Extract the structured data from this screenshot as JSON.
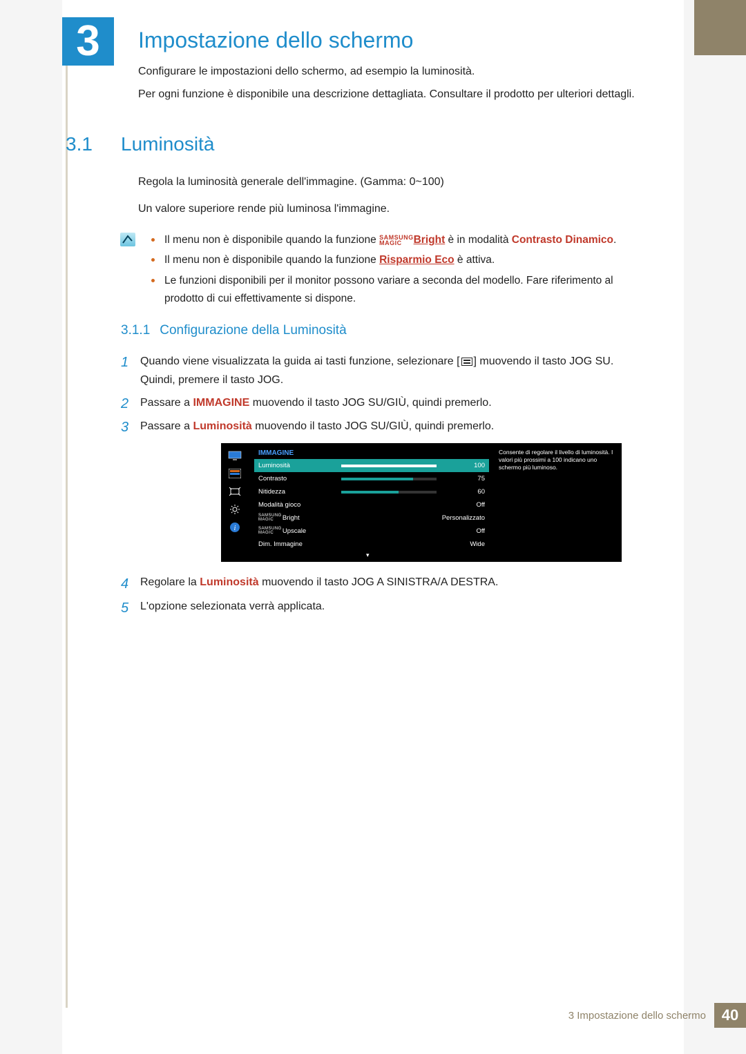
{
  "chapter": {
    "num": "3",
    "title": "Impostazione dello schermo"
  },
  "intro": {
    "p1": "Configurare le impostazioni dello schermo, ad esempio la luminosità.",
    "p2": "Per ogni funzione è disponibile una descrizione dettagliata. Consultare il prodotto per ulteriori dettagli."
  },
  "sec": {
    "num": "3.1",
    "title": "Luminosità"
  },
  "body": {
    "p1": "Regola la luminosità generale dell'immagine. (Gamma: 0~100)",
    "p2": "Un valore superiore rende più luminosa l'immagine."
  },
  "bullets": {
    "b1_a": "Il menu non è disponibile quando la funzione ",
    "b1_tag_top": "SAMSUNG",
    "b1_tag_bot": "MAGIC",
    "b1_bright": "Bright",
    "b1_b": " è in modalità ",
    "b1_mode": "Contrasto Dinamico",
    "b1_c": ".",
    "b2_a": "Il menu non è disponibile quando la funzione ",
    "b2_eco": "Risparmio Eco",
    "b2_b": " è attiva.",
    "b3": "Le funzioni disponibili per il monitor possono variare a seconda del modello. Fare riferimento al prodotto di cui effettivamente si dispone."
  },
  "subsec": {
    "num": "3.1.1",
    "title": "Configurazione della Luminosità"
  },
  "steps": {
    "s1a": "Quando viene visualizzata la guida ai tasti funzione, selezionare [",
    "s1b": "] muovendo il tasto JOG SU. Quindi, premere il tasto JOG.",
    "s2a": "Passare a ",
    "s2k": "IMMAGINE",
    "s2b": " muovendo il tasto JOG SU/GIÙ, quindi premerlo.",
    "s3a": "Passare a ",
    "s3k": "Luminosità",
    "s3b": " muovendo il tasto JOG SU/GIÙ, quindi premerlo.",
    "s4a": "Regolare la ",
    "s4k": "Luminosità",
    "s4b": " muovendo il tasto JOG A SINISTRA/A DESTRA.",
    "s5": "L'opzione selezionata verrà applicata."
  },
  "step_nums": {
    "n1": "1",
    "n2": "2",
    "n3": "3",
    "n4": "4",
    "n5": "5"
  },
  "osd": {
    "header": "IMMAGINE",
    "rows": {
      "r1": {
        "label": "Luminosità",
        "val": "100",
        "pct": 100
      },
      "r2": {
        "label": "Contrasto",
        "val": "75",
        "pct": 75
      },
      "r3": {
        "label": "Nitidezza",
        "val": "60",
        "pct": 60
      },
      "r4": {
        "label": "Modalità gioco",
        "val": "Off"
      },
      "r5": {
        "magic_top": "SAMSUNG",
        "magic_bot": "MAGIC",
        "label_suffix": "Bright",
        "val": "Personalizzato"
      },
      "r6": {
        "magic_top": "SAMSUNG",
        "magic_bot": "MAGIC",
        "label_suffix": "Upscale",
        "val": "Off"
      },
      "r7": {
        "label": "Dim. Immagine",
        "val": "Wide"
      }
    },
    "tip": "Consente di regolare il livello di luminosità. I valori più prossimi a 100 indicano uno schermo più luminoso.",
    "arrow": "▾"
  },
  "footer": {
    "text": "3 Impostazione dello schermo",
    "page": "40"
  }
}
